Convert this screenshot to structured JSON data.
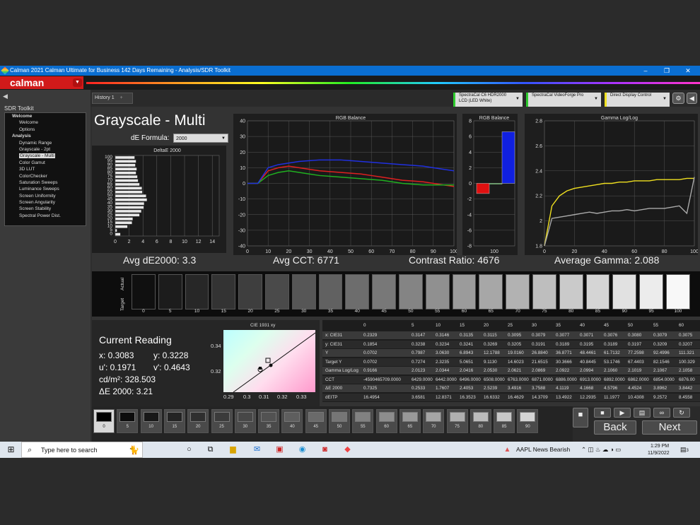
{
  "window": {
    "title": "Calman 2021 Calman Ultimate for Business 142 Days Remaining  - Analysis/SDR Toolkit",
    "minimize": "–",
    "maximize": "❐",
    "close": "✕"
  },
  "brand": {
    "logo": "calman",
    "menu_arrow": "▼"
  },
  "sidebar": {
    "title": "SDR Toolkit",
    "items": [
      {
        "label": "Welcome",
        "level": 0
      },
      {
        "label": "Welcome",
        "level": 1
      },
      {
        "label": "Options",
        "level": 1
      },
      {
        "label": "Analysis",
        "level": 0
      },
      {
        "label": "Dynamic Range",
        "level": 1
      },
      {
        "label": "Grayscale - 2pt",
        "level": 1
      },
      {
        "label": "Grayscale - Multi",
        "level": 1,
        "selected": true
      },
      {
        "label": "Color Gamut",
        "level": 1
      },
      {
        "label": "3D LUT",
        "level": 1
      },
      {
        "label": "ColorChecker",
        "level": 1
      },
      {
        "label": "Saturation Sweeps",
        "level": 1
      },
      {
        "label": "Luminance Sweeps",
        "level": 1
      },
      {
        "label": "Screen Uniformity",
        "level": 1
      },
      {
        "label": "Screen Angularity",
        "level": 1
      },
      {
        "label": "Screen Stability",
        "level": 1
      },
      {
        "label": "Spectral Power Dist.",
        "level": 1
      }
    ]
  },
  "history": {
    "tab": "History 1",
    "add": "+"
  },
  "devices": [
    {
      "line1": "SpectraCal C6 HDR2000",
      "line2": "LCD (LED White)",
      "color": "#2ecc2e"
    },
    {
      "line1": "SpectraCal VideoForge Pro",
      "line2": "",
      "color": "#2ecc2e"
    },
    {
      "line1": "Direct Display Control",
      "line2": "",
      "color": "#f0e020"
    }
  ],
  "page": {
    "title": "Grayscale - Multi",
    "de_formula_label": "dE Formula:",
    "de_formula_value": "2000"
  },
  "stats": {
    "avg_de": "Avg dE2000: 3.3",
    "avg_cct": "Avg CCT: 6771",
    "contrast": "Contrast Ratio: 4676",
    "gamma": "Average Gamma: 2.088"
  },
  "charts": {
    "deltae": {
      "title": "DeltaE 2000",
      "xticks": [
        "0",
        "2",
        "4",
        "6",
        "8",
        "10",
        "12",
        "14"
      ],
      "yticks": [
        "100",
        "95",
        "90",
        "85",
        "80",
        "75",
        "70",
        "65",
        "60",
        "55",
        "50",
        "45",
        "40",
        "35",
        "30",
        "25",
        "20",
        "15",
        "10",
        "5",
        "0"
      ]
    },
    "rgb": {
      "title": "RGB Balance",
      "xticks": [
        "0",
        "10",
        "20",
        "30",
        "40",
        "50",
        "60",
        "70",
        "80",
        "90",
        "100"
      ],
      "yticks": [
        "40",
        "30",
        "20",
        "10",
        "0",
        "-10",
        "-20",
        "-30",
        "-40"
      ]
    },
    "rgbbar": {
      "title": "RGB Balance",
      "xticks": [
        "100"
      ],
      "yticks": [
        "8",
        "6",
        "4",
        "2",
        "0",
        "-2",
        "-4",
        "-6",
        "-8"
      ]
    },
    "gamma": {
      "title": "Gamma Log/Log",
      "xticks": [
        "0",
        "20",
        "40",
        "60",
        "80",
        "100"
      ],
      "yticks": [
        "2.8",
        "2.6",
        "2.4",
        "2.2",
        "2",
        "1.8"
      ]
    }
  },
  "chart_data": [
    {
      "type": "bar",
      "title": "DeltaE 2000",
      "categories": [
        "0",
        "5",
        "10",
        "15",
        "20",
        "25",
        "30",
        "35",
        "40",
        "45",
        "50",
        "55",
        "60",
        "65",
        "70",
        "75",
        "80",
        "85",
        "90",
        "95",
        "100"
      ],
      "values": [
        0.73,
        0.25,
        1.76,
        2.41,
        2.52,
        3.49,
        3.76,
        4.11,
        4.17,
        4.58,
        4.45,
        3.9,
        3.84,
        3.5,
        3.3,
        3.2,
        3.0,
        3.1,
        2.9,
        3.0,
        2.8
      ],
      "xlim": [
        0,
        15
      ]
    },
    {
      "type": "line",
      "title": "RGB Balance",
      "x": [
        0,
        5,
        10,
        15,
        20,
        25,
        30,
        35,
        40,
        45,
        50,
        55,
        60,
        65,
        70,
        75,
        80,
        85,
        90,
        95,
        100
      ],
      "series": [
        {
          "color": "#e02020",
          "values": [
            0,
            0,
            8,
            10,
            11,
            10,
            9,
            8,
            7.5,
            7,
            6.5,
            6,
            5,
            4,
            3,
            2,
            1.5,
            1,
            0,
            -1,
            -2
          ]
        },
        {
          "color": "#20b020",
          "values": [
            0,
            0,
            5,
            7,
            8,
            7,
            6,
            5,
            4.5,
            4,
            3.5,
            3,
            2.5,
            2,
            1,
            0,
            -0.5,
            -1,
            -1,
            -1,
            -1
          ]
        },
        {
          "color": "#2030e0",
          "values": [
            0,
            0,
            10,
            12,
            13,
            14,
            14.5,
            15,
            15,
            15,
            14.5,
            14,
            13.5,
            13,
            12.5,
            12,
            11.5,
            11,
            10,
            9,
            8
          ]
        }
      ],
      "ylim": [
        -40,
        40
      ],
      "xlim": [
        0,
        100
      ]
    },
    {
      "type": "bar",
      "title": "RGB Balance",
      "categories": [
        "R",
        "G",
        "B"
      ],
      "values": [
        -1.3,
        -0.1,
        6.6
      ],
      "ylim": [
        -8,
        8
      ]
    },
    {
      "type": "line",
      "title": "Gamma Log/Log",
      "x": [
        0,
        5,
        10,
        15,
        20,
        25,
        30,
        35,
        40,
        45,
        50,
        55,
        60,
        65,
        70,
        75,
        80,
        85,
        90,
        95,
        100
      ],
      "series": [
        {
          "color": "#f0e020",
          "values": [
            1.8,
            2.12,
            2.2,
            2.24,
            2.26,
            2.27,
            2.28,
            2.29,
            2.3,
            2.3,
            2.31,
            2.31,
            2.32,
            2.32,
            2.32,
            2.33,
            2.33,
            2.33,
            2.33,
            2.34,
            2.34
          ]
        },
        {
          "color": "#aaaaaa",
          "values": [
            1.8,
            2.02,
            2.03,
            2.04,
            2.05,
            2.06,
            2.07,
            2.06,
            2.07,
            2.08,
            2.08,
            2.09,
            2.08,
            2.09,
            2.1,
            2.1,
            2.1,
            2.11,
            2.12,
            2.06,
            2.35
          ]
        }
      ],
      "ylim": [
        1.8,
        2.8
      ],
      "xlim": [
        0,
        100
      ]
    }
  ],
  "swatches": {
    "actual_label": "Actual",
    "target_label": "Target",
    "levels": [
      "0",
      "5",
      "10",
      "15",
      "20",
      "25",
      "30",
      "35",
      "40",
      "45",
      "50",
      "55",
      "60",
      "65",
      "70",
      "75",
      "80",
      "85",
      "90",
      "95",
      "100"
    ]
  },
  "reading": {
    "title": "Current Reading",
    "x": "x: 0.3083",
    "y": "y: 0.3228",
    "u": "u': 0.1971",
    "v": "v': 0.4643",
    "cd": "cd/m²: 328.503",
    "de": "ΔE 2000: 3.21"
  },
  "cie": {
    "title": "CIE 1931 xy",
    "xticks": [
      "0.29",
      "0.3",
      "0.31",
      "0.32",
      "0.33"
    ],
    "yticks": [
      "0.34",
      "0.32"
    ]
  },
  "table": {
    "headers": [
      "",
      "0",
      "5",
      "10",
      "15",
      "20",
      "25",
      "30",
      "35",
      "40",
      "45",
      "50",
      "55",
      "60"
    ],
    "rows": [
      [
        "x: CIE31",
        "0.2329",
        "0.3147",
        "0.3146",
        "0.3135",
        "0.3115",
        "0.3095",
        "0.3079",
        "0.3077",
        "0.3071",
        "0.3076",
        "0.3080",
        "0.3079",
        "0.3075"
      ],
      [
        "y: CIE31",
        "0.1854",
        "0.3238",
        "0.3234",
        "0.3241",
        "0.3269",
        "0.3205",
        "0.3191",
        "0.3189",
        "0.3195",
        "0.3189",
        "0.3197",
        "0.3209",
        "0.3207"
      ],
      [
        "Y",
        "0.0702",
        "0.7987",
        "3.0630",
        "6.8943",
        "12.1788",
        "19.0160",
        "26.8840",
        "36.8771",
        "48.4461",
        "61.7132",
        "77.2598",
        "92.4996",
        "111.321"
      ],
      [
        "Target Y",
        "0.0702",
        "0.7274",
        "2.3235",
        "5.0651",
        "9.1130",
        "14.6023",
        "21.6515",
        "30.3666",
        "40.8445",
        "53.1746",
        "67.4403",
        "82.1546",
        "100.329"
      ],
      [
        "Gamma Log/Log",
        "0.9166",
        "2.0123",
        "2.0344",
        "2.0416",
        "2.0530",
        "2.0621",
        "2.0869",
        "2.0922",
        "2.0994",
        "2.1060",
        "2.1019",
        "2.1067",
        "2.1058"
      ],
      [
        "CCT",
        "-4590465709.0000",
        "6429.0000",
        "6442.0000",
        "6496.0000",
        "6508.0000",
        "6763.0000",
        "6871.0000",
        "6886.0000",
        "6913.0000",
        "6892.0000",
        "6862.0000",
        "6854.0000",
        "6876.00"
      ],
      [
        "ΔE 2000",
        "0.7325",
        "0.2533",
        "1.7607",
        "2.4053",
        "2.5239",
        "3.4916",
        "3.7588",
        "4.1119",
        "4.1668",
        "4.5796",
        "4.4524",
        "3.8962",
        "3.8442"
      ],
      [
        "dEITP",
        "16.4954",
        "3.6581",
        "12.8371",
        "16.3523",
        "16.6332",
        "16.4629",
        "14.3709",
        "13.4922",
        "12.2935",
        "11.1977",
        "10.4308",
        "9.2572",
        "8.4558"
      ]
    ]
  },
  "patches": [
    "0",
    "5",
    "10",
    "15",
    "20",
    "25",
    "30",
    "35",
    "40",
    "45",
    "50",
    "55",
    "60",
    "65",
    "70",
    "75",
    "80",
    "85",
    "90"
  ],
  "nav": {
    "back": "Back",
    "next": "Next"
  },
  "taskbar": {
    "search_placeholder": "Type here to search",
    "news": "AAPL  News Bearish",
    "time": "1:29 PM",
    "date": "11/9/2022",
    "notif": "3"
  }
}
